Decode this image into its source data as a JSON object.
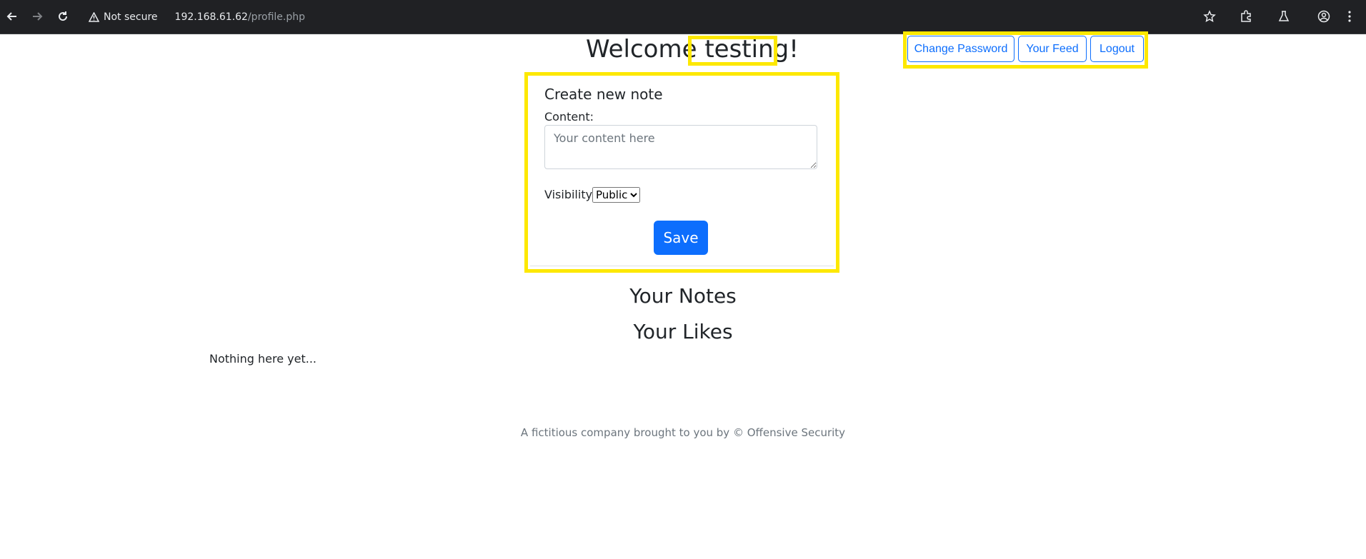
{
  "browser": {
    "security_label": "Not secure",
    "url_host": "192.168.61.62",
    "url_path": "/profile.php"
  },
  "header": {
    "welcome_prefix": "Welcome ",
    "username": "testing!"
  },
  "nav": {
    "change_password": "Change Password",
    "your_feed": "Your Feed",
    "logout": "Logout"
  },
  "note_form": {
    "title": "Create new note",
    "content_label": "Content:",
    "content_placeholder": "Your content here",
    "visibility_label": "Visibility:",
    "visibility_selected": "Public",
    "save_label": "Save"
  },
  "sections": {
    "notes_heading": "Your Notes",
    "likes_heading": "Your Likes",
    "empty_text": "Nothing here yet..."
  },
  "footer": {
    "text": "A fictitious company brought to you by © Offensive Security"
  },
  "colors": {
    "highlight": "#fde800",
    "primary": "#0d6efd"
  }
}
